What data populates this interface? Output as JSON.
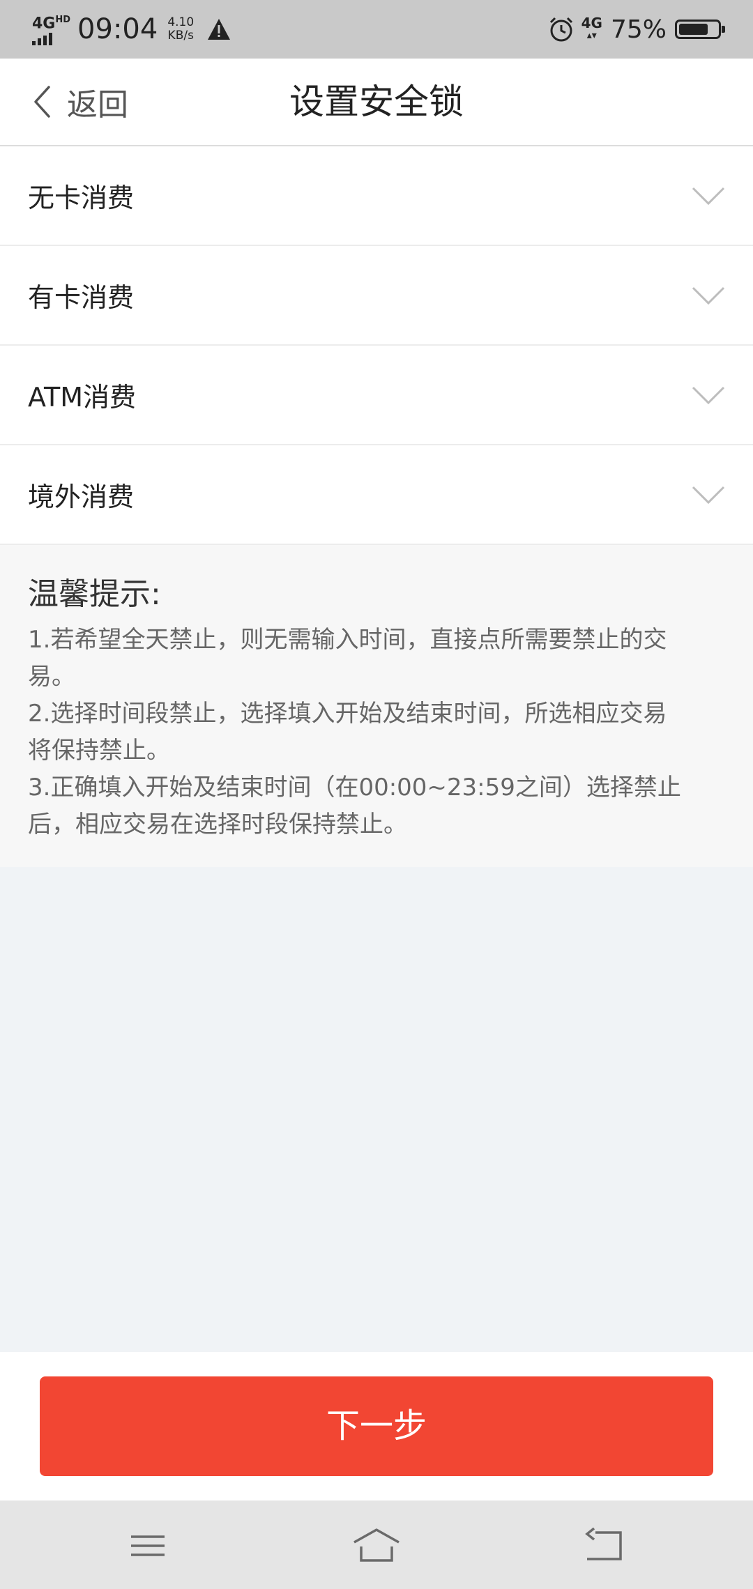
{
  "status_bar": {
    "network": "4G",
    "network_sup": "HD",
    "time": "09:04",
    "speed_value": "4.10",
    "speed_unit": "KB/s",
    "network_right": "4G",
    "battery_percent": "75%",
    "battery_level": 0.75
  },
  "nav": {
    "back_label": "返回",
    "title": "设置安全锁"
  },
  "options": [
    {
      "label": "无卡消费"
    },
    {
      "label": "有卡消费"
    },
    {
      "label": "ATM消费"
    },
    {
      "label": "境外消费"
    }
  ],
  "tips": {
    "title": "温馨提示:",
    "lines": [
      "1.若希望全天禁止，则无需输入时间，直接点所需要禁止的交",
      "易。",
      "2.选择时间段禁止，选择填入开始及结束时间，所选相应交易",
      "将保持禁止。",
      "3.正确填入开始及结束时间（在00:00~23:59之间）选择禁止",
      "后，相应交易在选择时段保持禁止。"
    ]
  },
  "next_button": {
    "label": "下一步",
    "color": "#f24633"
  },
  "icons": {
    "back": "chevron-left-icon",
    "expand": "chevron-down-icon",
    "menu": "menu-icon",
    "home": "home-icon",
    "return": "return-icon",
    "alarm": "alarm-icon",
    "warning": "warning-icon",
    "battery": "battery-icon"
  }
}
